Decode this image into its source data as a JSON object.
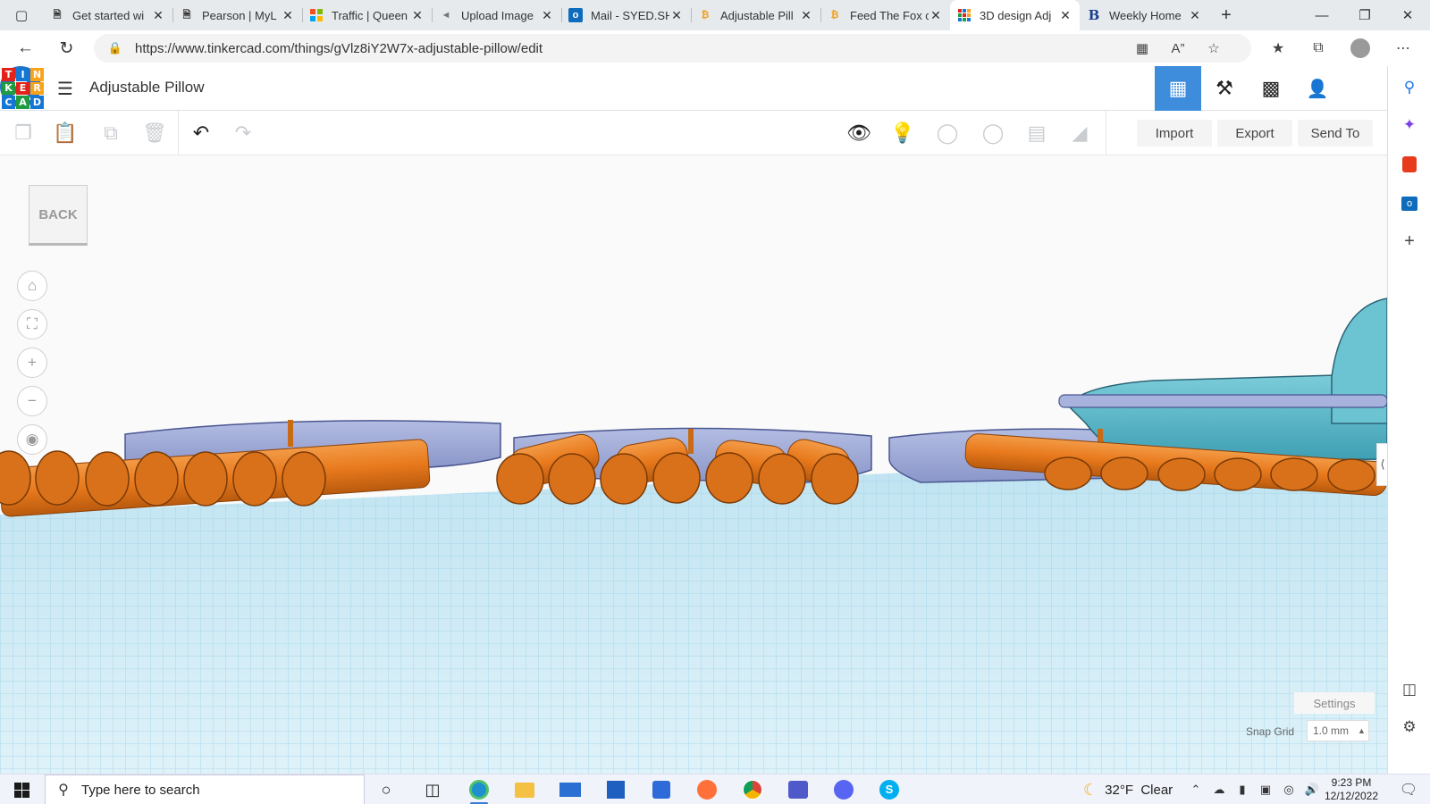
{
  "browser": {
    "tabs": [
      {
        "title": "Get started wi",
        "icon": "document-icon"
      },
      {
        "title": "Pearson | MyL",
        "icon": "document-icon"
      },
      {
        "title": "Traffic | Queen",
        "icon": "grid-logo-icon"
      },
      {
        "title": "Upload Image",
        "icon": "eye-icon"
      },
      {
        "title": "Mail - SYED.SH",
        "icon": "outlook-icon"
      },
      {
        "title": "Adjustable Pill",
        "icon": "site-b-icon"
      },
      {
        "title": "Feed The Fox c",
        "icon": "site-b-icon"
      },
      {
        "title": "3D design Adj",
        "icon": "tinkercad-icon",
        "active": true
      },
      {
        "title": "Weekly Home",
        "icon": "b-logo-icon"
      }
    ],
    "url": "https://www.tinkercad.com/things/gVlz8iY2W7x-adjustable-pillow/edit"
  },
  "app": {
    "logo_letters": [
      "T",
      "I",
      "N",
      "K",
      "E",
      "R",
      "C",
      "A",
      "D"
    ],
    "logo_colors": [
      "#e2231a",
      "#1477d4",
      "#f9a31b",
      "#1f9c42",
      "#e2231a",
      "#f9a31b",
      "#1477d4",
      "#1f9c42",
      "#1477d4"
    ],
    "title": "Adjustable Pillow"
  },
  "toolbar": {
    "import_label": "Import",
    "export_label": "Export",
    "sendto_label": "Send To"
  },
  "viewport": {
    "back_label": "BACK",
    "settings_label": "Settings",
    "snap_label": "Snap Grid",
    "snap_value": "1.0 mm"
  },
  "taskbar": {
    "search_placeholder": "Type here to search",
    "weather": "32°F  Clear",
    "time": "9:23 PM",
    "date": "12/12/2022"
  },
  "colors": {
    "accent": "#3e8ddd",
    "cylinder": "#e8791c",
    "base": "#9aa5d4",
    "teal_shape": "#5bb7c8"
  }
}
